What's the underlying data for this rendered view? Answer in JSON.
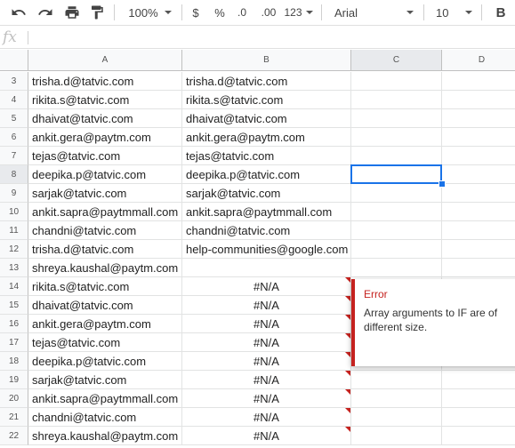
{
  "toolbar": {
    "undo_icon": "undo-icon",
    "redo_icon": "redo-icon",
    "print_icon": "print-icon",
    "paint_format_icon": "paint-format-icon",
    "zoom": "100%",
    "currency": "$",
    "percent": "%",
    "decrease_decimal": ".0",
    "increase_decimal": ".00",
    "more_formats": "123",
    "font": "Arial",
    "font_size": "10",
    "bold": "B"
  },
  "formula_bar": {
    "fx_label": "fx",
    "value": ""
  },
  "columns": [
    "A",
    "B",
    "C",
    "D"
  ],
  "rows": [
    {
      "num": "3",
      "a": "trisha.d@tatvic.com",
      "b": "trisha.d@tatvic.com"
    },
    {
      "num": "4",
      "a": "rikita.s@tatvic.com",
      "b": "rikita.s@tatvic.com"
    },
    {
      "num": "5",
      "a": "dhaivat@tatvic.com",
      "b": "dhaivat@tatvic.com"
    },
    {
      "num": "6",
      "a": "ankit.gera@paytm.com",
      "b": "ankit.gera@paytm.com"
    },
    {
      "num": "7",
      "a": "tejas@tatvic.com",
      "b": "tejas@tatvic.com"
    },
    {
      "num": "8",
      "a": "deepika.p@tatvic.com",
      "b": "deepika.p@tatvic.com"
    },
    {
      "num": "9",
      "a": "sarjak@tatvic.com",
      "b": "sarjak@tatvic.com"
    },
    {
      "num": "10",
      "a": "ankit.sapra@paytmmall.com",
      "b": "ankit.sapra@paytmmall.com"
    },
    {
      "num": "11",
      "a": "chandni@tatvic.com",
      "b": "chandni@tatvic.com"
    },
    {
      "num": "12",
      "a": "trisha.d@tatvic.com",
      "b": "help-communities@google.com"
    },
    {
      "num": "13",
      "a": "shreya.kaushal@paytm.com",
      "b": ""
    },
    {
      "num": "14",
      "a": "rikita.s@tatvic.com",
      "b": "#N/A"
    },
    {
      "num": "15",
      "a": "dhaivat@tatvic.com",
      "b": "#N/A"
    },
    {
      "num": "16",
      "a": "ankit.gera@paytm.com",
      "b": "#N/A"
    },
    {
      "num": "17",
      "a": "tejas@tatvic.com",
      "b": "#N/A"
    },
    {
      "num": "18",
      "a": "deepika.p@tatvic.com",
      "b": "#N/A"
    },
    {
      "num": "19",
      "a": "sarjak@tatvic.com",
      "b": "#N/A"
    },
    {
      "num": "20",
      "a": "ankit.sapra@paytmmall.com",
      "b": "#N/A"
    },
    {
      "num": "21",
      "a": "chandni@tatvic.com",
      "b": "#N/A"
    },
    {
      "num": "22",
      "a": "shreya.kaushal@paytm.com",
      "b": "#N/A"
    }
  ],
  "selected_cell": "C8",
  "error_popup": {
    "title": "Error",
    "message": "Array arguments to IF are of different size."
  },
  "colors": {
    "selection": "#1a73e8",
    "error": "#c5221f"
  }
}
